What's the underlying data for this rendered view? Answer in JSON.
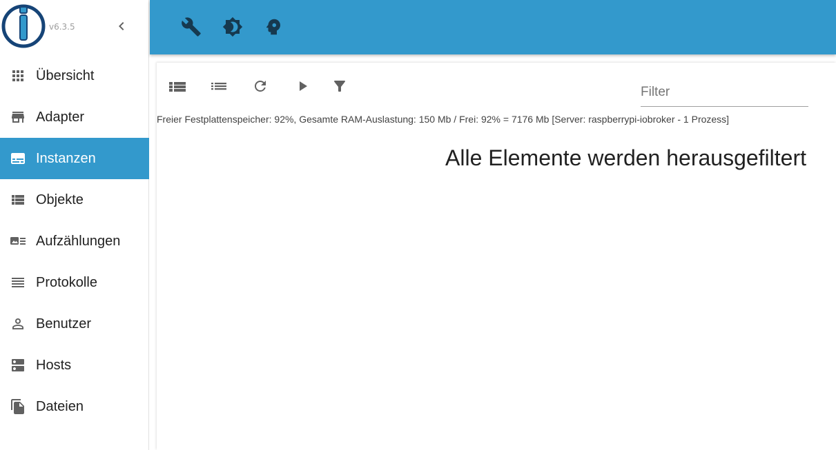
{
  "app": {
    "version": "v6.3.5"
  },
  "sidebar": {
    "items": [
      {
        "label": "Übersicht",
        "icon": "apps-grid-icon"
      },
      {
        "label": "Adapter",
        "icon": "store-icon"
      },
      {
        "label": "Instanzen",
        "icon": "instances-icon",
        "active": true
      },
      {
        "label": "Objekte",
        "icon": "list-icon"
      },
      {
        "label": "Aufzählungen",
        "icon": "enums-icon"
      },
      {
        "label": "Protokolle",
        "icon": "lines-icon"
      },
      {
        "label": "Benutzer",
        "icon": "user-icon"
      },
      {
        "label": "Hosts",
        "icon": "dns-icon"
      },
      {
        "label": "Dateien",
        "icon": "file-copy-icon"
      }
    ]
  },
  "toolbar": {
    "filter_placeholder": "Filter"
  },
  "content": {
    "status_line": "Freier Festplattenspeicher: 92%, Gesamte RAM-Auslastung: 150 Mb / Frei: 92% = 7176 Mb [Server: raspberrypi-iobroker - 1 Prozess]",
    "empty_message": "Alle Elemente werden herausgefiltert"
  },
  "colors": {
    "accent": "#3399cc",
    "icon_gray": "#616161",
    "appbar_icon": "#16394f"
  }
}
